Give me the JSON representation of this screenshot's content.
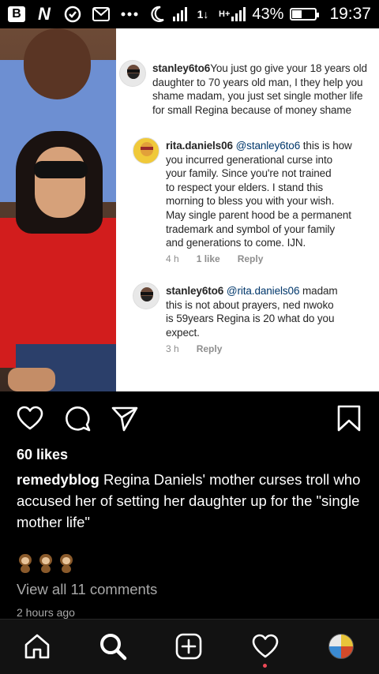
{
  "status_bar": {
    "network_type": "H+",
    "battery_level": "43%",
    "battery_fraction": 0.43,
    "time": "19:37",
    "icons": [
      "app-b-icon",
      "app-n-icon",
      "vpn-shield-icon",
      "gmail-icon",
      "more-dots-icon",
      "moon-icon",
      "signal-icon",
      "data-arrows-icon",
      "signal-icon",
      "battery-icon"
    ]
  },
  "post_image": {
    "comments": [
      {
        "username": "stanley6to6",
        "text": " You just go give your 18 years old daughter to 70 years old man, I they help you shame madam, you just set single mother life for small Regina because of money shame",
        "lines": [
          "stanley6to6 You just go give your 18 years old",
          "daughter to 70 years old man, I they help you",
          "shame madam, you just set single mother life",
          "for small Regina because of money shame"
        ]
      },
      {
        "username": "rita.daniels06",
        "mention": "@stanley6to6",
        "lines": [
          "rita.daniels06 @stanley6to6 this is how",
          "you incurred generational curse into",
          "your family. Since you're not trained",
          "to respect your elders. I stand this",
          "morning to bless you with your wish.",
          "May single parent hood be a permanent",
          "trademark and symbol of your family",
          "and generations to come. IJN."
        ],
        "time": "4 h",
        "likes": "1 like",
        "reply": "Reply"
      },
      {
        "username": "stanley6to6",
        "mention": "@rita.daniels06",
        "lines": [
          "stanley6to6 @rita.daniels06 madam",
          "this is not about prayers, ned nwoko",
          "is 59years Regina is 20 what do you",
          "expect."
        ],
        "time": "3 h",
        "reply": "Reply"
      }
    ]
  },
  "actions": {
    "icons": [
      "heart-icon",
      "comment-icon",
      "share-icon",
      "bookmark-icon"
    ]
  },
  "post": {
    "likes": "60 likes",
    "caption_user": "remedyblog",
    "caption_text": " Regina Daniels' mother curses troll who accused her of setting her daughter up for the \"single mother life\"",
    "emoji_reaction": "monkey-emoji x3",
    "view_comments": "View all 11 comments",
    "time_ago": "2 hours ago"
  },
  "bottom_nav": {
    "items": [
      "home-icon",
      "search-icon",
      "add-post-icon",
      "activity-heart-icon",
      "profile-avatar"
    ]
  },
  "colors": {
    "background": "#000000",
    "link": "#00376b",
    "muted": "#a8a8a8",
    "notification": "#ed4956"
  }
}
